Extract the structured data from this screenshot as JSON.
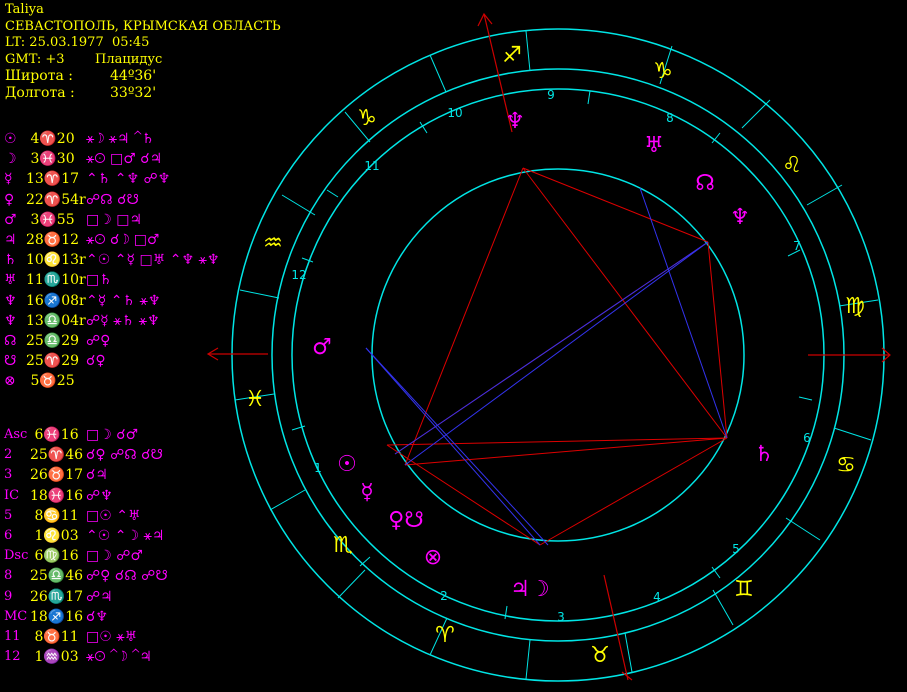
{
  "header": {
    "name": "Taliya",
    "place": "СЕВАСТОПОЛЬ, КРЫМСКАЯ ОБЛАСТЬ",
    "lt": "LT: 25.03.1977  05:45",
    "gmt": "GMT: +3",
    "house_system": "Плацидус",
    "lat_label": "Широта :",
    "lat_value": "44º36'",
    "lon_label": "Долгота :",
    "lon_value": "33º32'"
  },
  "colors": {
    "background": "#000000",
    "ring": "#00e5e5",
    "text_yellow": "#ffff00",
    "symbol_magenta": "#ff00ff",
    "aspect_red": "#ff0000",
    "aspect_blue": "#3333ff"
  },
  "planets": [
    {
      "symbol": "☉",
      "pos": " 4♈20",
      "aspects": "⚹☽ ⚹♃ ⌃♄"
    },
    {
      "symbol": "☽",
      "pos": " 3♓30",
      "aspects": "⚹☉ □♂ ☌♃"
    },
    {
      "symbol": "☿",
      "pos": "13♈17",
      "aspects": "⌃♄ ⌃♆ ☍♆"
    },
    {
      "symbol": "♀",
      "pos": "22♈54r",
      "aspects": "☍☊ ☌☋"
    },
    {
      "symbol": "♂",
      "pos": " 3♓55",
      "aspects": "□☽ □♃"
    },
    {
      "symbol": "♃",
      "pos": "28♉12",
      "aspects": "⚹☉ ☌☽ □♂"
    },
    {
      "symbol": "♄",
      "pos": "10♌13r",
      "aspects": "⌃☉ ⌃☿ □♅ ⌃♆ ⚹♆"
    },
    {
      "symbol": "♅",
      "pos": "11♏10r",
      "aspects": "□♄"
    },
    {
      "symbol": "♆",
      "pos": "16♐08r",
      "aspects": "⌃☿ ⌃♄ ⚹♆"
    },
    {
      "symbol": "♆",
      "pos": "13♎04r",
      "aspects": "☍☿ ⚹♄ ⚹♆"
    },
    {
      "symbol": "☊",
      "pos": "25♎29",
      "aspects": "☍♀"
    },
    {
      "symbol": "☋",
      "pos": "25♈29",
      "aspects": "☌♀"
    },
    {
      "symbol": "⊗",
      "pos": " 5♉25",
      "aspects": ""
    }
  ],
  "houses": [
    {
      "name": "Asc",
      "pos": " 6♓16",
      "aspects": "□☽ ☌♂"
    },
    {
      "name": "2",
      "pos": "25♈46",
      "aspects": "☌♀ ☍☊ ☌☋"
    },
    {
      "name": "3",
      "pos": "26♉17",
      "aspects": "☌♃"
    },
    {
      "name": "IC",
      "pos": "18♓16",
      "aspects": "☍♆"
    },
    {
      "name": "5",
      "pos": " 8♋11",
      "aspects": "□☉ ⌃♅"
    },
    {
      "name": "6",
      "pos": " 1♌03",
      "aspects": "⌃☉ ⌃☽ ⚹♃"
    },
    {
      "name": "Dsc",
      "pos": " 6♍16",
      "aspects": "□☽ ☍♂"
    },
    {
      "name": "8",
      "pos": "25♎46",
      "aspects": "☍♀ ☌☊ ☍☋"
    },
    {
      "name": "9",
      "pos": "26♏17",
      "aspects": "☍♃"
    },
    {
      "name": "MC",
      "pos": "18♐16",
      "aspects": "☌♆"
    },
    {
      "name": "11",
      "pos": " 8♉11",
      "aspects": "□☉ ⚹♅"
    },
    {
      "name": "12",
      "pos": " 1♒03",
      "aspects": "⚹☉ ⌃☽ ⌃♃"
    }
  ],
  "wheel": {
    "signs": [
      {
        "glyph": "♐",
        "name": "sagittarius"
      },
      {
        "glyph": "♑",
        "name": "capricorn"
      },
      {
        "glyph": "♌",
        "name": "leo"
      },
      {
        "glyph": "♍",
        "name": "virgo"
      },
      {
        "glyph": "♋",
        "name": "cancer"
      },
      {
        "glyph": "♊",
        "name": "gemini"
      },
      {
        "glyph": "♉",
        "name": "taurus"
      },
      {
        "glyph": "♈",
        "name": "aries"
      },
      {
        "glyph": "♓",
        "name": "pisces"
      },
      {
        "glyph": "♒",
        "name": "aquarius"
      },
      {
        "glyph": "♑",
        "name": "capricorn-2"
      },
      {
        "glyph": "♏",
        "name": "scorpio"
      }
    ],
    "house_numbers": [
      "9",
      "8",
      "10",
      "11",
      "12",
      "7",
      "6",
      "1",
      "5",
      "4",
      "2",
      "3"
    ],
    "planet_glyphs": [
      {
        "glyph": "♆",
        "name": "neptune"
      },
      {
        "glyph": "♅",
        "name": "uranus"
      },
      {
        "glyph": "☊",
        "name": "north-node"
      },
      {
        "glyph": "♆",
        "name": "pluto"
      },
      {
        "glyph": "♂",
        "name": "mars"
      },
      {
        "glyph": "♄",
        "name": "saturn"
      },
      {
        "glyph": "☉",
        "name": "sun"
      },
      {
        "glyph": "☿",
        "name": "mercury"
      },
      {
        "glyph": "♀☋",
        "name": "venus-south-node"
      },
      {
        "glyph": "⊗",
        "name": "part-of-fortune"
      },
      {
        "glyph": "♃☽",
        "name": "jupiter-moon"
      }
    ]
  }
}
